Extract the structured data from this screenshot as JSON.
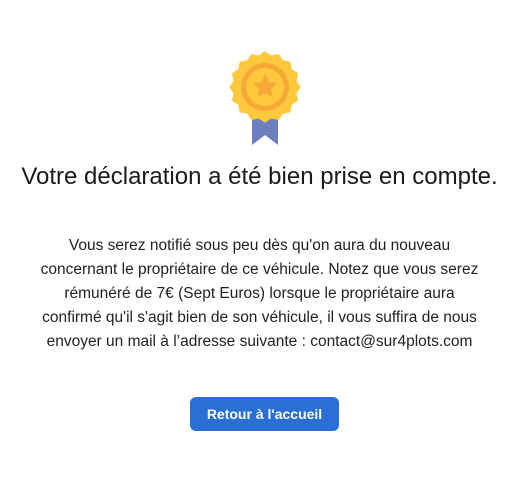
{
  "confirmation": {
    "icon": "award-ribbon-star-icon",
    "title": "Votre déclaration a été bien prise en compte.",
    "message": "Vous serez notifié sous peu dès qu'on aura du nouveau concernant le propriétaire de ce véhicule. Notez que vous serez rémunéré de 7€ (Sept Euros) lorsque le propriétaire aura confirmé qu'il s'agit bien de son véhicule, il vous suffira de nous envoyer un mail à l’adresse suivante : contact@sur4plots.com",
    "button_label": "Retour à l'accueil"
  },
  "colors": {
    "accent": "#2a6fd6",
    "badge_gold": "#ffc83d",
    "badge_orange": "#f7a836",
    "ribbon": "#6d7fc0"
  }
}
